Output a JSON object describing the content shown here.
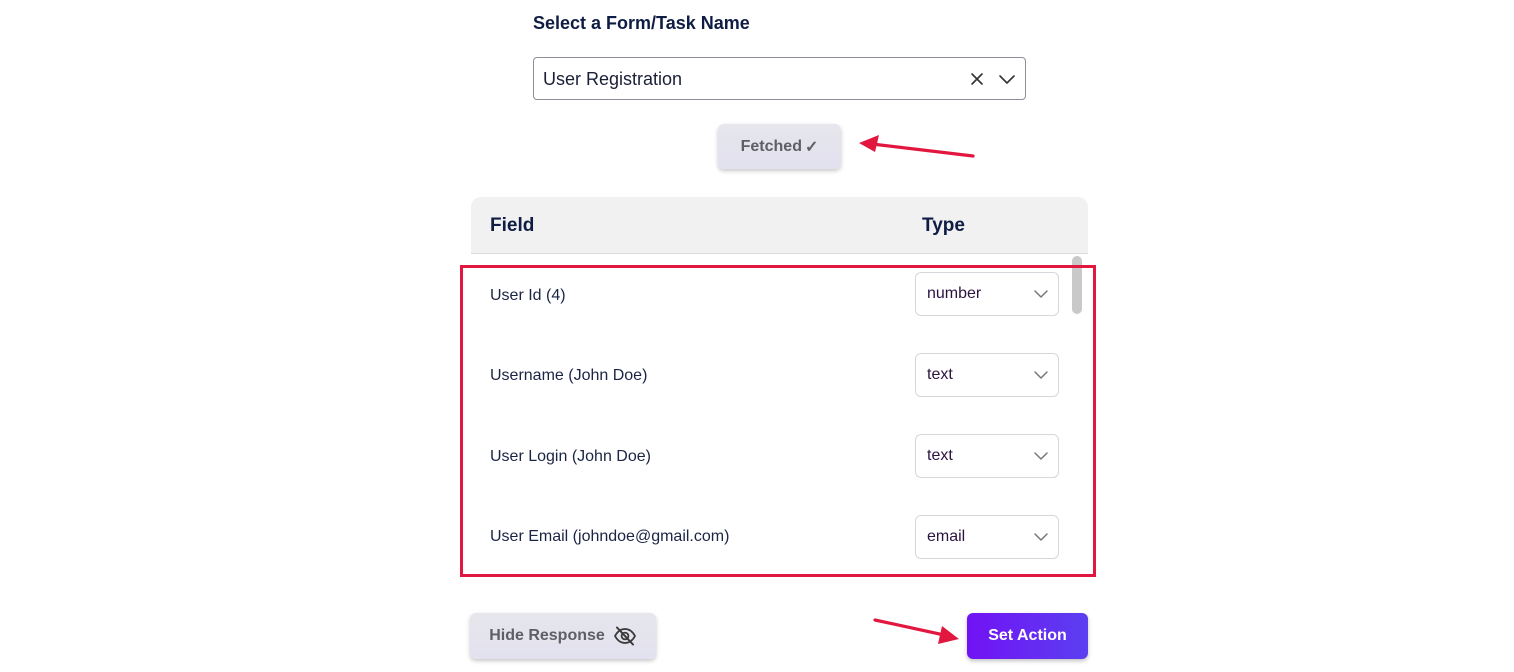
{
  "form_selector": {
    "label": "Select a Form/Task Name",
    "selected_value": "User Registration"
  },
  "fetch_status": {
    "label": "Fetched",
    "check_glyph": "✓"
  },
  "table": {
    "headers": {
      "field": "Field",
      "type": "Type"
    },
    "rows": [
      {
        "field": "User Id (4)",
        "type": "number"
      },
      {
        "field": "Username (John Doe)",
        "type": "text"
      },
      {
        "field": "User Login (John Doe)",
        "type": "text"
      },
      {
        "field": "User Email (johndoe@gmail.com)",
        "type": "email"
      }
    ]
  },
  "actions": {
    "hide_response_label": "Hide Response",
    "set_action_label": "Set Action"
  },
  "icons": {
    "clear": "close-icon",
    "dropdown": "chevron-down-icon",
    "hide": "eye-off-icon",
    "annotation": "arrow-icon"
  },
  "colors": {
    "annotation_red": "#e2173f",
    "primary_purple": "#7212f5",
    "heading_navy": "#0f1d45"
  }
}
